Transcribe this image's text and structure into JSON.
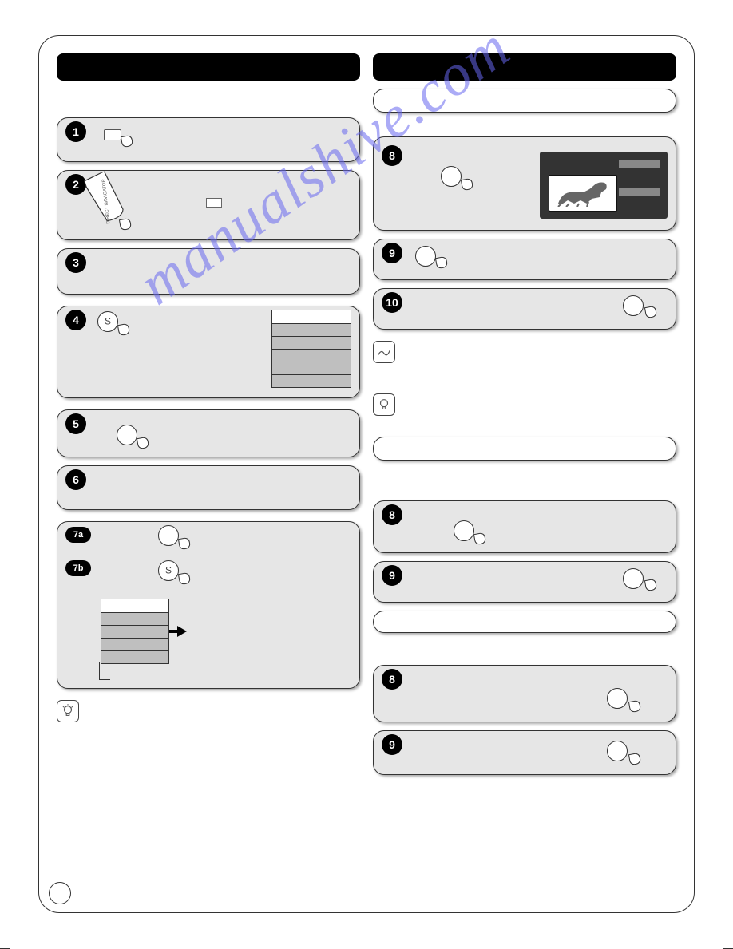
{
  "watermark": "manualshive.com",
  "left": {
    "spacer_heading": "",
    "step1": {
      "badge": "1"
    },
    "step2": {
      "badge": "2",
      "tab_text": "DIRECT NAVIGATOR"
    },
    "step3": {
      "badge": "3"
    },
    "step4": {
      "badge": "4",
      "s_label": "S"
    },
    "step5": {
      "badge": "5"
    },
    "step6": {
      "badge": "6"
    },
    "step7": {
      "badge_a": "7a",
      "badge_b": "7b",
      "s_label": "S"
    }
  },
  "right": {
    "heading_box1": "",
    "step8a": {
      "badge": "8"
    },
    "step9a": {
      "badge": "9"
    },
    "step10": {
      "badge": "10"
    },
    "heading_box2": "",
    "step8b": {
      "badge": "8"
    },
    "step9b": {
      "badge": "9"
    },
    "step8c": {
      "badge": "8"
    },
    "step9c": {
      "badge": "9"
    },
    "heading_box3": ""
  }
}
